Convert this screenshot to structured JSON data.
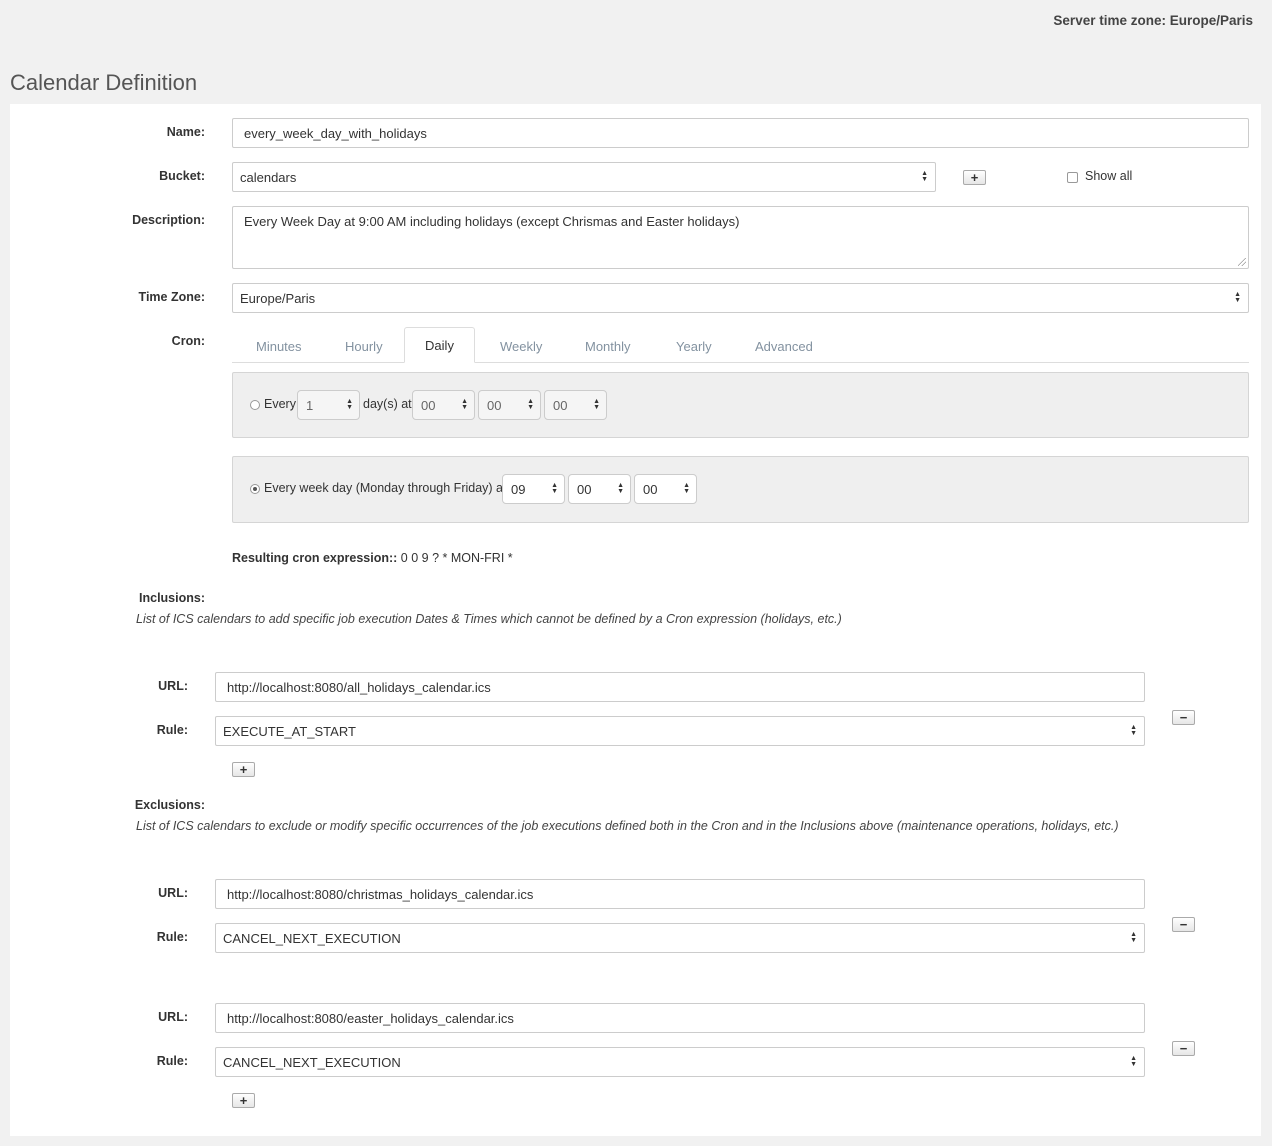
{
  "header": {
    "server_time_zone": "Server time zone: Europe/Paris",
    "page_title": "Calendar Definition"
  },
  "form": {
    "name_label": "Name:",
    "name_value": "every_week_day_with_holidays",
    "bucket_label": "Bucket:",
    "bucket_value": "calendars",
    "show_all_label": "Show all",
    "description_label": "Description:",
    "description_value": "Every Week Day at 9:00 AM including holidays (except Chrismas and Easter holidays)",
    "timezone_label": "Time Zone:",
    "timezone_value": "Europe/Paris",
    "cron_label": "Cron:"
  },
  "cron": {
    "tabs": [
      {
        "label": "Minutes",
        "active": false
      },
      {
        "label": "Hourly",
        "active": false
      },
      {
        "label": "Daily",
        "active": true
      },
      {
        "label": "Weekly",
        "active": false
      },
      {
        "label": "Monthly",
        "active": false
      },
      {
        "label": "Yearly",
        "active": false
      },
      {
        "label": "Advanced",
        "active": false
      }
    ],
    "option1": {
      "selected": false,
      "every_label": "Every",
      "days_value": "1",
      "days_at_label": "day(s) at",
      "hour": "00",
      "minute": "00",
      "second": "00"
    },
    "option2": {
      "selected": true,
      "label": "Every week day (Monday through Friday) at",
      "hour": "09",
      "minute": "00",
      "second": "00"
    },
    "resulting_label": "Resulting cron expression::",
    "resulting_value": "0 0 9 ? * MON-FRI *"
  },
  "inclusions": {
    "title": "Inclusions:",
    "description": "List of ICS calendars to add specific job execution Dates & Times which cannot be defined by a Cron expression (holidays, etc.)",
    "items": [
      {
        "url_label": "URL:",
        "url": "http://localhost:8080/all_holidays_calendar.ics",
        "rule_label": "Rule:",
        "rule": "EXECUTE_AT_START"
      }
    ]
  },
  "exclusions": {
    "title": "Exclusions:",
    "description": "List of ICS calendars to exclude or modify specific occurrences of the job executions defined both in the Cron and in the Inclusions above (maintenance operations, holidays, etc.)",
    "items": [
      {
        "url_label": "URL:",
        "url": "http://localhost:8080/christmas_holidays_calendar.ics",
        "rule_label": "Rule:",
        "rule": "CANCEL_NEXT_EXECUTION"
      },
      {
        "url_label": "URL:",
        "url": "http://localhost:8080/easter_holidays_calendar.ics",
        "rule_label": "Rule:",
        "rule": "CANCEL_NEXT_EXECUTION"
      }
    ]
  },
  "icons": {
    "plus": "+",
    "minus": "−"
  }
}
